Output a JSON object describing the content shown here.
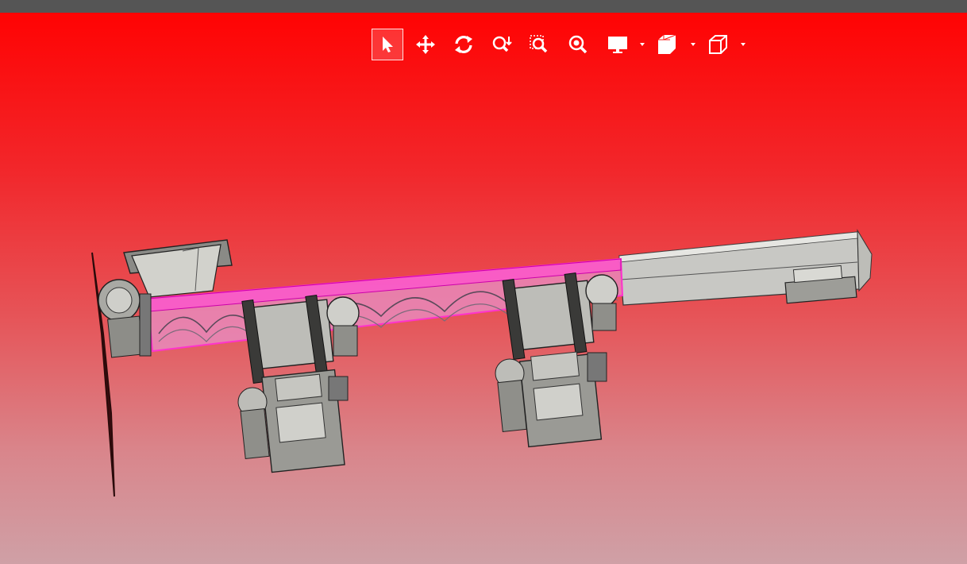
{
  "viewer": {
    "background_top": "#ff0303",
    "background_bottom": "#cfa0a6",
    "selection_highlight": "#ff33cc",
    "topbar_color": "#555555"
  },
  "toolbar": {
    "tools": [
      {
        "name": "select",
        "icon": "pointer-arrow-icon",
        "active": true
      },
      {
        "name": "pan",
        "icon": "move-arrows-icon",
        "active": false
      },
      {
        "name": "rotate",
        "icon": "rotate-icon",
        "active": false
      },
      {
        "name": "zoom-dynamic",
        "icon": "zoom-dynamic-icon",
        "active": false
      },
      {
        "name": "zoom-window",
        "icon": "zoom-window-icon",
        "active": false
      },
      {
        "name": "zoom-fit",
        "icon": "zoom-fit-icon",
        "active": false
      },
      {
        "name": "display-mode",
        "icon": "monitor-icon",
        "has_dropdown": true
      },
      {
        "name": "section",
        "icon": "section-cube-icon",
        "has_dropdown": true
      },
      {
        "name": "standard-views",
        "icon": "cube-view-icon",
        "has_dropdown": true
      }
    ]
  }
}
